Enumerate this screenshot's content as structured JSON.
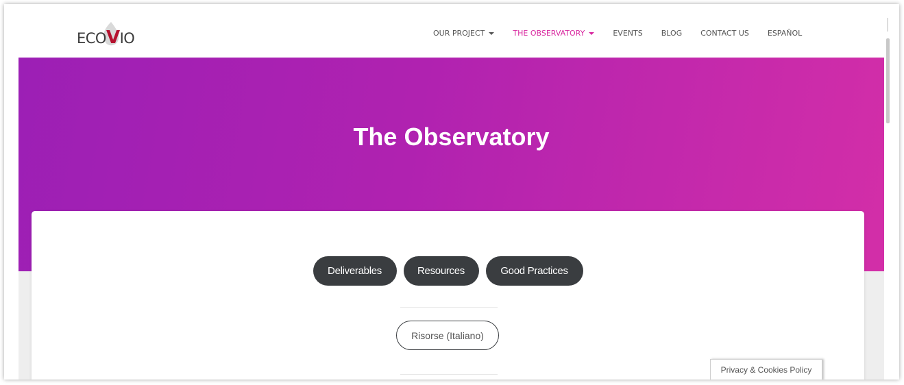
{
  "header": {
    "logo": {
      "text_before": "ECO",
      "text_v": "V",
      "text_after": "IO",
      "brand_color": "#b5122f"
    },
    "nav": [
      {
        "label": "OUR PROJECT",
        "has_dropdown": true,
        "active": false
      },
      {
        "label": "THE OBSERVATORY",
        "has_dropdown": true,
        "active": true
      },
      {
        "label": "EVENTS",
        "has_dropdown": false,
        "active": false
      },
      {
        "label": "BLOG",
        "has_dropdown": false,
        "active": false
      },
      {
        "label": "CONTACT US",
        "has_dropdown": false,
        "active": false
      },
      {
        "label": "ESPAÑOL",
        "has_dropdown": false,
        "active": false
      }
    ],
    "active_color": "#d8279f"
  },
  "hero": {
    "title": "The Observatory",
    "gradient_start": "#9c1fb5",
    "gradient_end": "#d32ea8"
  },
  "content": {
    "pills": [
      "Deliverables",
      "Resources",
      "Good Practices"
    ],
    "outline_button": "Risorse (Italiano)"
  },
  "cookie": {
    "label": "Privacy & Cookies Policy"
  }
}
